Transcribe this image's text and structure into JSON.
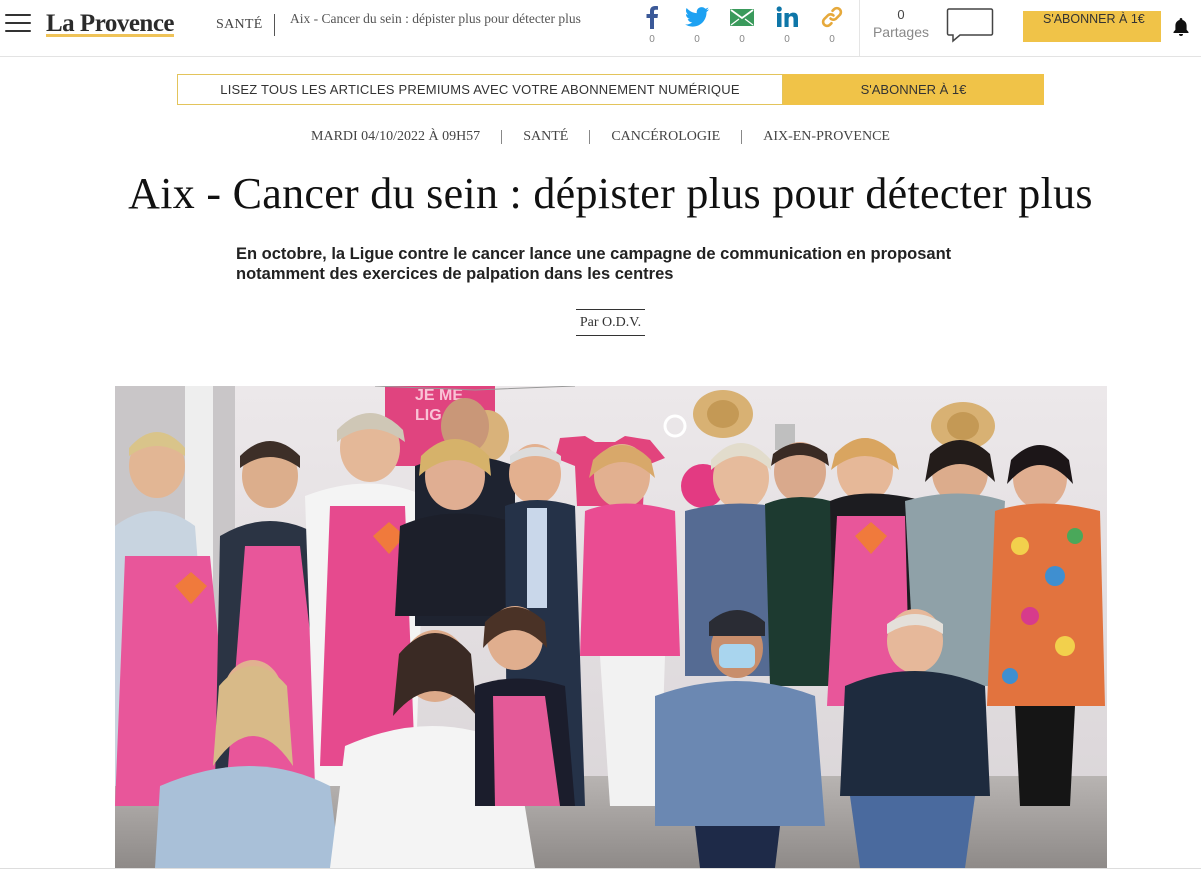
{
  "header": {
    "logo": "La Provence",
    "section": "SANTÉ",
    "title": "Aix - Cancer du sein : dépister plus pour détecter plus",
    "share_buttons": [
      {
        "network": "facebook-icon",
        "count": "0",
        "color": "#3b5998"
      },
      {
        "network": "twitter-icon",
        "count": "0",
        "color": "#1da1f2"
      },
      {
        "network": "email-icon",
        "count": "0",
        "color": "#3a9a5c"
      },
      {
        "network": "linkedin-icon",
        "count": "0",
        "color": "#0e76a8"
      },
      {
        "network": "link-icon",
        "count": "0",
        "color": "#e6a93b"
      }
    ],
    "shares_total": "0",
    "shares_label": "Partages",
    "subscribe_label": "S'ABONNER À 1€"
  },
  "premium_banner": {
    "text": "LISEZ TOUS LES ARTICLES PREMIUMS AVEC VOTRE ABONNEMENT NUMÉRIQUE",
    "button": "S'ABONNER À 1€"
  },
  "meta": {
    "date": "MARDI 04/10/2022 à 09H57",
    "tags": [
      "SANTÉ",
      "CANCÉROLOGIE",
      "AIX-EN-PROVENCE"
    ]
  },
  "article": {
    "headline": "Aix - Cancer du sein : dépister plus pour détecter plus",
    "standfirst": "En octobre, la Ligue contre le cancer lance une campagne de communication en proposant notamment des exercices de palpation dans les centres",
    "byline": "Par O.D.V.",
    "photo_sign_text": "JE ME LIG"
  },
  "colors": {
    "accent_yellow": "#f0c348",
    "banner_border": "#e3c45b",
    "apron_pink": "#e8448a"
  }
}
